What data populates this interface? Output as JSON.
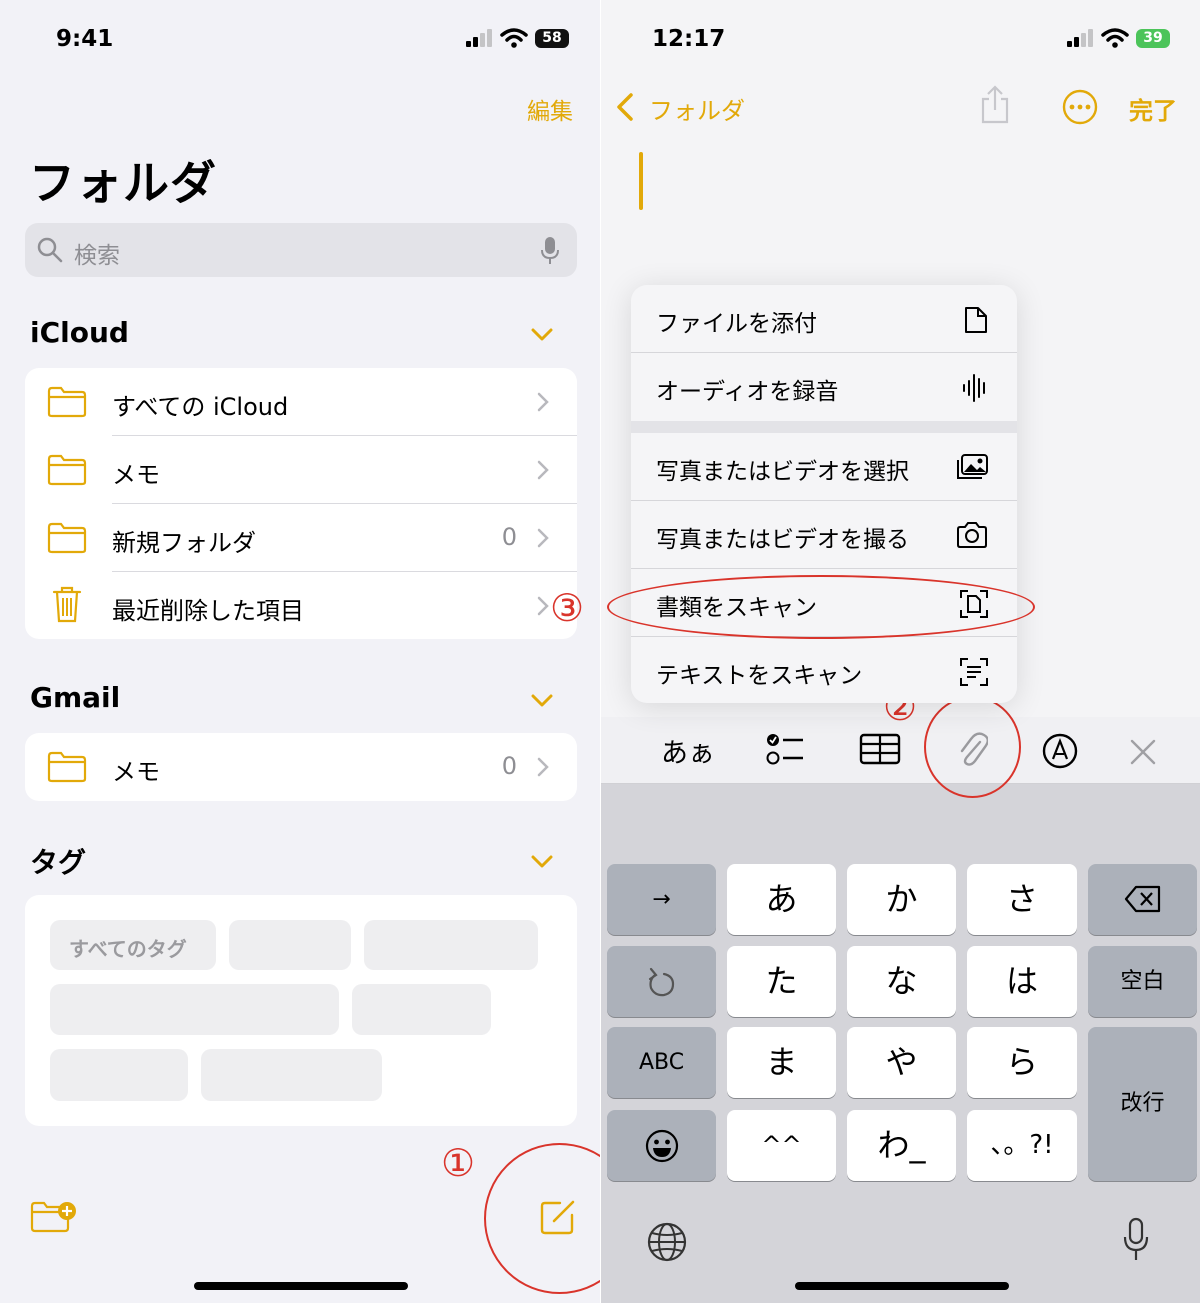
{
  "left": {
    "status": {
      "time": "9:41",
      "battery": "58"
    },
    "edit_label": "編集",
    "title": "フォルダ",
    "search": {
      "placeholder": "検索"
    },
    "icloud": {
      "title": "iCloud",
      "items": [
        {
          "label": "すべての iCloud",
          "count": ""
        },
        {
          "label": "メモ",
          "count": ""
        },
        {
          "label": "新規フォルダ",
          "count": "0"
        },
        {
          "label": "最近削除した項目",
          "count": ""
        }
      ]
    },
    "gmail": {
      "title": "Gmail",
      "items": [
        {
          "label": "メモ",
          "count": "0"
        }
      ]
    },
    "tags": {
      "title": "タグ",
      "first_tag": "すべてのタグ"
    },
    "annotation": "①"
  },
  "right": {
    "status": {
      "time": "12:17",
      "battery": "39"
    },
    "back_label": "フォルダ",
    "done_label": "完了",
    "menu": [
      {
        "label": "ファイルを添付",
        "icon": "document-icon"
      },
      {
        "label": "オーディオを録音",
        "icon": "waveform-icon"
      },
      {
        "label": "写真またはビデオを選択",
        "icon": "photo-library-icon"
      },
      {
        "label": "写真またはビデオを撮る",
        "icon": "camera-icon"
      },
      {
        "label": "書類をスキャン",
        "icon": "doc-scan-icon"
      },
      {
        "label": "テキストをスキャン",
        "icon": "text-scan-icon"
      }
    ],
    "toolbar": {
      "format_label": "あぁ"
    },
    "keyboard": {
      "rows": [
        [
          "→",
          "あ",
          "か",
          "さ",
          "⌫"
        ],
        [
          "↺",
          "た",
          "な",
          "は",
          "空白"
        ],
        [
          "ABC",
          "ま",
          "や",
          "ら",
          "改行"
        ],
        [
          "☺",
          "^^",
          "わ_",
          "、。?!",
          ""
        ]
      ],
      "abc": "ABC",
      "space": "空白",
      "return": "改行"
    },
    "annotation2": "②",
    "annotation3": "③"
  },
  "colors": {
    "accent": "#e2a909",
    "annotation": "#d9342b"
  }
}
